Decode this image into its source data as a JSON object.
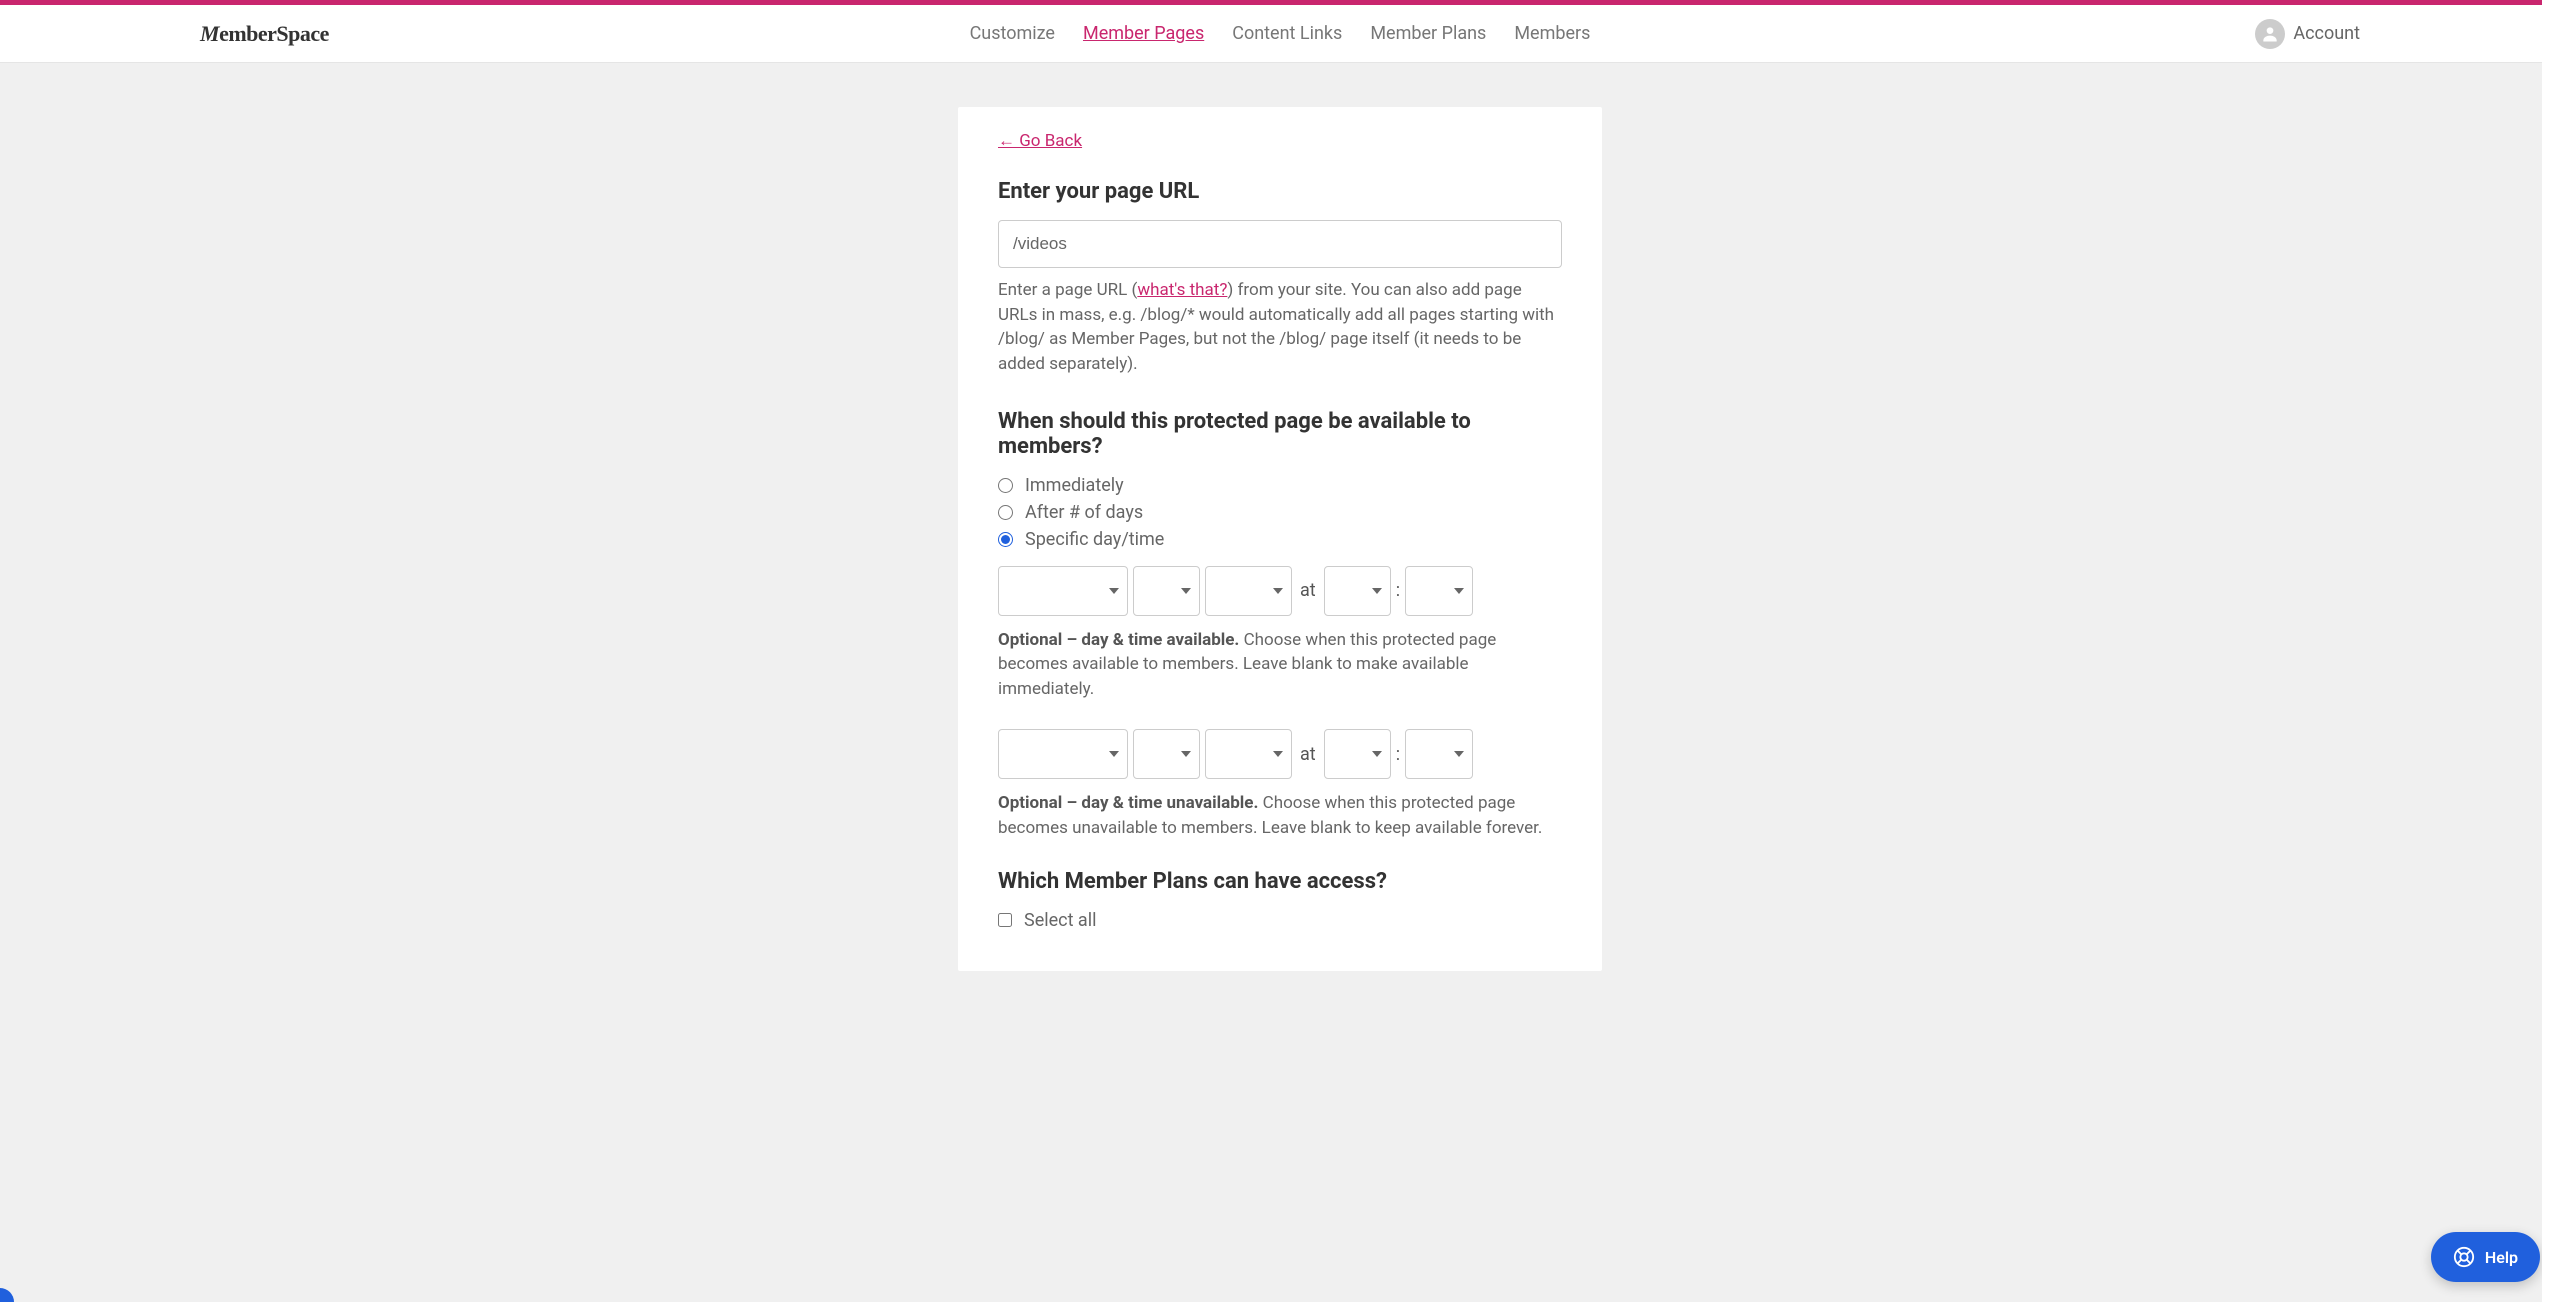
{
  "header": {
    "logo": "MemberSpace",
    "nav": {
      "customize": "Customize",
      "member_pages": "Member Pages",
      "content_links": "Content Links",
      "member_plans": "Member Plans",
      "members": "Members"
    },
    "account": "Account"
  },
  "main": {
    "go_back": "← Go Back",
    "url_section": {
      "title": "Enter your page URL",
      "value": "/videos",
      "help_prefix": "Enter a page URL (",
      "help_link": "what's that?",
      "help_suffix": ") from your site. You can also add page URLs in mass, e.g. /blog/* would automatically add all pages starting with /blog/ as Member Pages, but not the /blog/ page itself (it needs to be added separately)."
    },
    "when_section": {
      "title": "When should this protected page be available to members?",
      "opt_immediately": "Immediately",
      "opt_after_days": "After # of days",
      "opt_specific": "Specific day/time",
      "at_label": "at",
      "colon": ":",
      "available_bold": "Optional – day & time available.",
      "available_text": " Choose when this protected page becomes available to members. Leave blank to make available immediately.",
      "unavailable_bold": "Optional – day & time unavailable.",
      "unavailable_text": " Choose when this protected page becomes unavailable to members. Leave blank to keep available forever."
    },
    "plans_section": {
      "title": "Which Member Plans can have access?",
      "select_all": "Select all"
    }
  },
  "help": {
    "label": "Help"
  }
}
